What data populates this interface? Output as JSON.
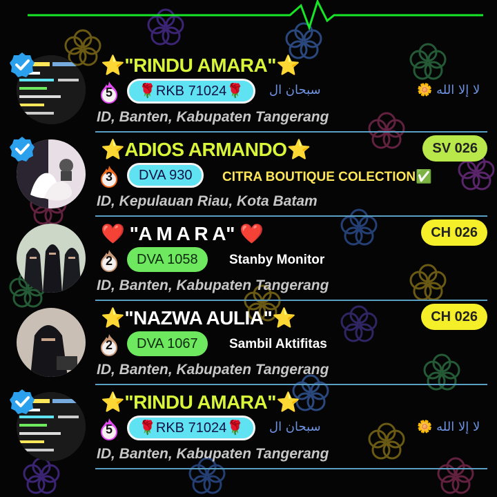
{
  "users": [
    {
      "name": "⭐\"RINDU AMARA\"⭐",
      "name_color": "#d9f53a",
      "level": "5",
      "level_color": "#e24bf2",
      "id_tag": "🌹RKB 71024🌹",
      "id_style": "cyan",
      "status": "",
      "arabic_left": "سبحان ال",
      "arabic_right": "🌼 لا إلا الله",
      "location": "ID, Banten, Kabupaten Tangerang",
      "verified": true,
      "room": "",
      "avatar_icon": "screenshot-collage-avatar"
    },
    {
      "name": "⭐ADIOS ARMANDO⭐",
      "name_color": "#d9f53a",
      "level": "3",
      "level_color": "#f06a1e",
      "id_tag": "DVA 930",
      "id_style": "cyan",
      "status": "CITRA BOUTIQUE COLECTION✅",
      "status_color": "#ffe75a",
      "location": "ID, Kepulauan Riau, Kota Batam",
      "verified": true,
      "room": "SV 026",
      "room_color": "#b8e84a",
      "avatar_icon": "swan-avatar"
    },
    {
      "name": "❤️ \"A M A R A\" ❤️",
      "name_color": "#ffffff",
      "level": "2",
      "level_color": "#c99a7a",
      "id_tag": "DVA 1058",
      "id_style": "green",
      "status": "Stanby Monitor",
      "status_color": "#ffffff",
      "location": "ID, Banten, Kabupaten Tangerang",
      "verified": false,
      "room": "CH 026",
      "room_color": "#f5ef2a",
      "avatar_icon": "veiled-women-avatar"
    },
    {
      "name": "⭐\"NAZWA AULIA\"⭐",
      "name_color": "#ffffff",
      "level": "2",
      "level_color": "#c99a7a",
      "id_tag": "DVA 1067",
      "id_style": "green",
      "status": "Sambil Aktifitas",
      "status_color": "#ffffff",
      "location": "ID, Banten, Kabupaten Tangerang",
      "verified": false,
      "room": "CH 026",
      "room_color": "#f5ef2a",
      "avatar_icon": "veiled-woman-avatar"
    },
    {
      "name": "⭐\"RINDU AMARA\"⭐",
      "name_color": "#d9f53a",
      "level": "5",
      "level_color": "#e24bf2",
      "id_tag": "🌹RKB 71024🌹",
      "id_style": "cyan",
      "status": "",
      "arabic_left": "سبحان ال",
      "arabic_right": "🌼 لا إلا الله",
      "location": "ID, Banten, Kabupaten Tangerang",
      "verified": true,
      "room": "",
      "avatar_icon": "screenshot-collage-avatar"
    }
  ]
}
